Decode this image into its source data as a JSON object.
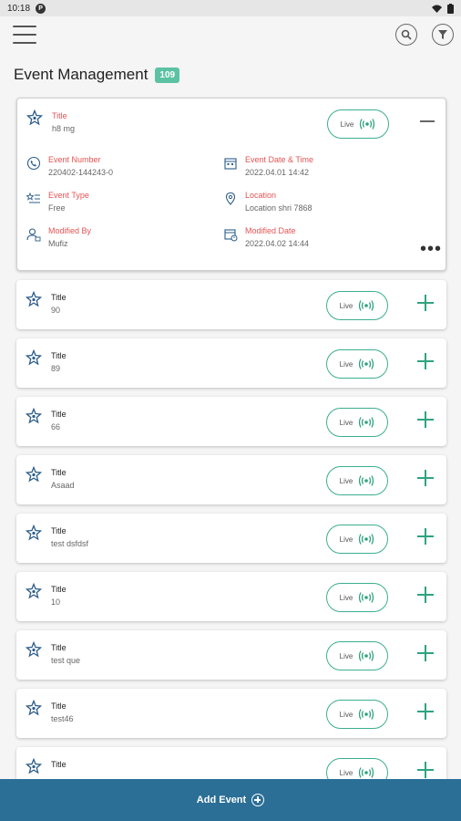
{
  "status_bar": {
    "time": "10:18",
    "app_badge": "P"
  },
  "header": {
    "title": "Event Management",
    "count": "109"
  },
  "expanded_event": {
    "title_label": "Title",
    "title_value": "h8 mg",
    "live_label": "Live",
    "fields": {
      "event_number": {
        "label": "Event Number",
        "value": "220402-144243-0"
      },
      "event_date": {
        "label": "Event Date & Time",
        "value": "2022.04.01 14:42"
      },
      "event_type": {
        "label": "Event Type",
        "value": "Free"
      },
      "location": {
        "label": "Location",
        "value": "Location shri 7868"
      },
      "modified_by": {
        "label": "Modified By",
        "value": "Mufiz"
      },
      "modified_date": {
        "label": "Modified Date",
        "value": "2022.04.02 14:44"
      }
    }
  },
  "events": [
    {
      "title_label": "Title",
      "title_value": "90",
      "live_label": "Live"
    },
    {
      "title_label": "Title",
      "title_value": "89",
      "live_label": "Live"
    },
    {
      "title_label": "Title",
      "title_value": "66",
      "live_label": "Live"
    },
    {
      "title_label": "Title",
      "title_value": "Asaad",
      "live_label": "Live"
    },
    {
      "title_label": "Title",
      "title_value": "test dsfdsf",
      "live_label": "Live"
    },
    {
      "title_label": "Title",
      "title_value": "10",
      "live_label": "Live"
    },
    {
      "title_label": "Title",
      "title_value": "test que",
      "live_label": "Live"
    },
    {
      "title_label": "Title",
      "title_value": "test46",
      "live_label": "Live"
    },
    {
      "title_label": "Title",
      "title_value": "",
      "live_label": "Live"
    }
  ],
  "footer": {
    "add_event_label": "Add Event"
  },
  "colors": {
    "accent_green": "#2ea37f",
    "label_red": "#e55353",
    "footer_blue": "#2b6f96",
    "badge_green": "#5bc2a3"
  }
}
